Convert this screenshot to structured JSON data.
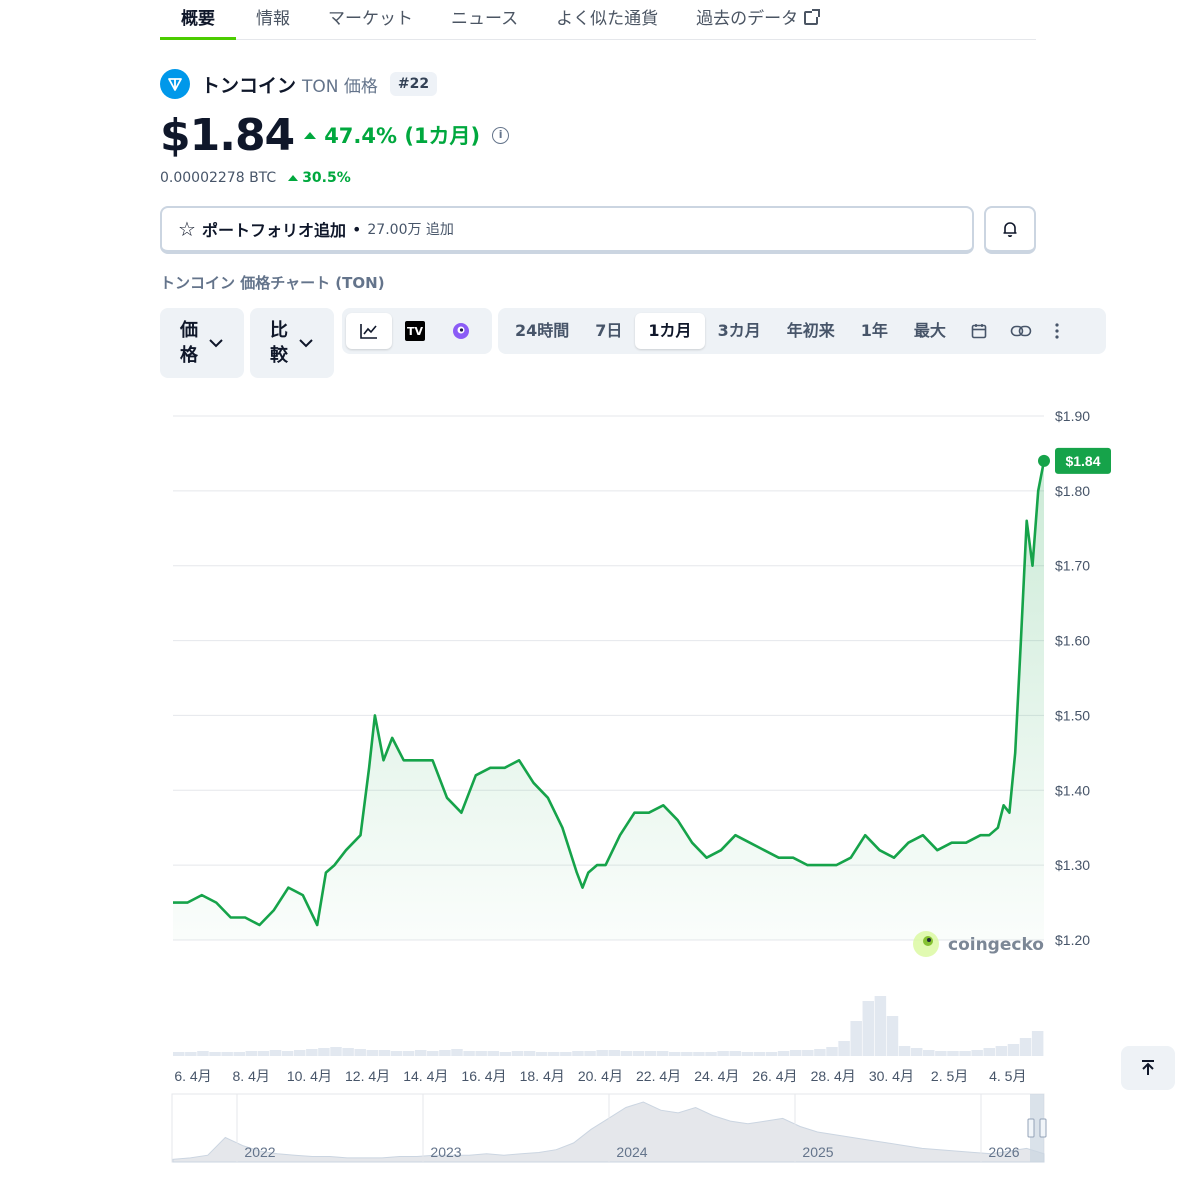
{
  "tabs": [
    {
      "label": "概要",
      "active": true
    },
    {
      "label": "情報"
    },
    {
      "label": "マーケット"
    },
    {
      "label": "ニュース"
    },
    {
      "label": "よく似た通貨"
    },
    {
      "label": "過去のデータ",
      "external": true
    }
  ],
  "coin": {
    "name": "トンコイン",
    "symbol_label": "TON 価格",
    "rank": "#22",
    "price": "$1.84",
    "change": "47.4% (1カ月)",
    "btc_price": "0.00002278 BTC",
    "btc_change": "30.5%",
    "brand_color": "#0098ea"
  },
  "actions": {
    "portfolio_label": "ポートフォリオ追加",
    "portfolio_count": "27.00万 追加"
  },
  "chart_title": "トンコイン 価格チャート (TON)",
  "controls": {
    "price_label": "価格",
    "compare_label": "比較",
    "ranges": [
      "24時間",
      "7日",
      "1カ月",
      "3カ月",
      "年初来",
      "1年",
      "最大"
    ],
    "active_range": "1カ月"
  },
  "watermark": "coingecko",
  "colors": {
    "up": "#00a83e",
    "line": "#16a34a",
    "accent": "#4bcc00"
  },
  "chart_data": {
    "type": "area",
    "x_ticks": [
      "6. 4月",
      "8. 4月",
      "10. 4月",
      "12. 4月",
      "14. 4月",
      "16. 4月",
      "18. 4月",
      "20. 4月",
      "22. 4月",
      "24. 4月",
      "26. 4月",
      "28. 4月",
      "30. 4月",
      "2. 5月",
      "4. 5月"
    ],
    "y_ticks": [
      "$1.90",
      "$1.80",
      "$1.70",
      "$1.60",
      "$1.50",
      "$1.40",
      "$1.30",
      "$1.20"
    ],
    "ylim": [
      1.2,
      1.9
    ],
    "current_label": "$1.84",
    "current_value": 1.84,
    "days": [
      5,
      5.5,
      6,
      6.5,
      7,
      7.5,
      8,
      8.5,
      9,
      9.5,
      10,
      10.3,
      10.6,
      11,
      11.5,
      11.8,
      12,
      12.3,
      12.6,
      13,
      13.5,
      14,
      14.5,
      15,
      15.5,
      16,
      16.5,
      17,
      17.5,
      18,
      18.5,
      19,
      19.2,
      19.4,
      19.7,
      20,
      20.5,
      21,
      21.5,
      22,
      22.5,
      23,
      23.5,
      24,
      24.5,
      25,
      25.5,
      26,
      26.5,
      27,
      27.5,
      28,
      28.5,
      29,
      29.5,
      30,
      30.5,
      1,
      1.5,
      2,
      2.5,
      3,
      3.3,
      3.6,
      3.8,
      4,
      4.2,
      4.4,
      4.6,
      4.8,
      5,
      5.2
    ],
    "values": [
      1.25,
      1.25,
      1.26,
      1.25,
      1.23,
      1.23,
      1.22,
      1.24,
      1.27,
      1.26,
      1.22,
      1.29,
      1.3,
      1.32,
      1.34,
      1.43,
      1.5,
      1.44,
      1.47,
      1.44,
      1.44,
      1.44,
      1.39,
      1.37,
      1.42,
      1.43,
      1.43,
      1.44,
      1.41,
      1.39,
      1.35,
      1.29,
      1.27,
      1.29,
      1.3,
      1.3,
      1.34,
      1.37,
      1.37,
      1.38,
      1.36,
      1.33,
      1.31,
      1.32,
      1.34,
      1.33,
      1.32,
      1.31,
      1.31,
      1.3,
      1.3,
      1.3,
      1.31,
      1.34,
      1.32,
      1.31,
      1.33,
      1.34,
      1.32,
      1.33,
      1.33,
      1.34,
      1.34,
      1.35,
      1.38,
      1.37,
      1.45,
      1.6,
      1.76,
      1.7,
      1.8,
      1.84
    ],
    "volume": [
      4,
      4,
      5,
      4,
      4,
      4,
      5,
      5,
      6,
      5,
      6,
      7,
      8,
      9,
      8,
      7,
      6,
      6,
      5,
      5,
      6,
      5,
      6,
      7,
      5,
      5,
      5,
      4,
      5,
      5,
      4,
      4,
      4,
      5,
      5,
      6,
      6,
      5,
      5,
      5,
      5,
      4,
      4,
      4,
      4,
      5,
      5,
      4,
      4,
      4,
      5,
      6,
      6,
      7,
      9,
      15,
      35,
      55,
      60,
      40,
      10,
      8,
      6,
      5,
      5,
      5,
      6,
      8,
      10,
      12,
      18,
      25
    ],
    "navigator": {
      "year_labels": [
        "2022",
        "2023",
        "2024",
        "2025",
        "2026"
      ],
      "values": [
        2,
        3,
        5,
        18,
        12,
        8,
        6,
        5,
        4,
        4,
        3,
        3,
        3,
        4,
        4,
        5,
        5,
        5,
        6,
        5,
        6,
        7,
        9,
        14,
        24,
        32,
        40,
        44,
        38,
        36,
        40,
        34,
        30,
        28,
        30,
        32,
        26,
        22,
        20,
        18,
        16,
        14,
        12,
        10,
        9,
        8,
        7,
        6,
        8,
        10,
        6
      ]
    }
  }
}
